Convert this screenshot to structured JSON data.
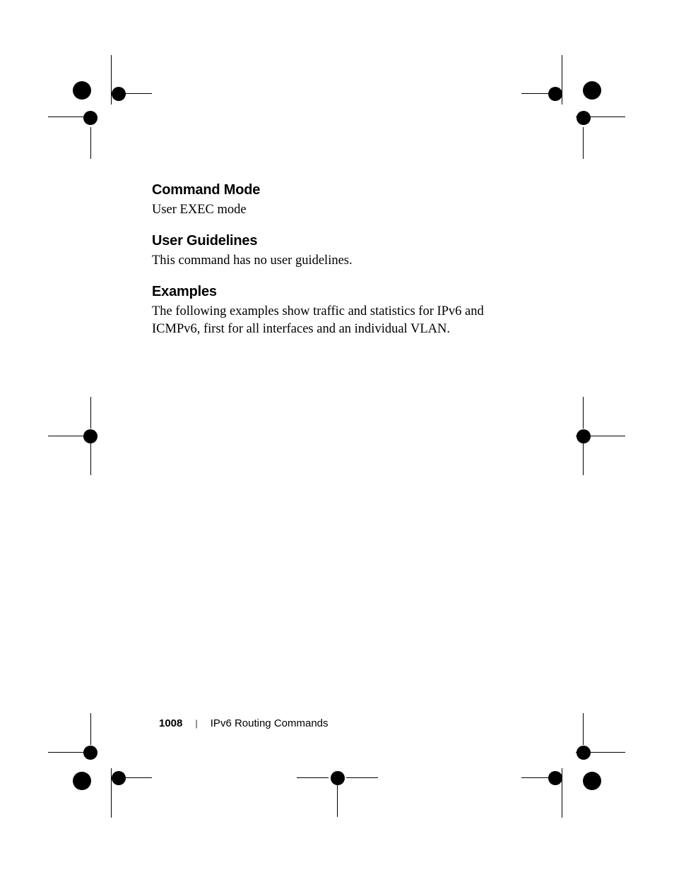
{
  "sections": {
    "command_mode": {
      "heading": "Command Mode",
      "body": "User EXEC mode"
    },
    "user_guidelines": {
      "heading": "User Guidelines",
      "body": "This command has no user guidelines."
    },
    "examples": {
      "heading": "Examples",
      "body": "The following examples show traffic and statistics for IPv6 and ICMPv6, first for all interfaces and an individual VLAN."
    }
  },
  "footer": {
    "page_number": "1008",
    "separator": "|",
    "section_title": "IPv6 Routing Commands"
  }
}
